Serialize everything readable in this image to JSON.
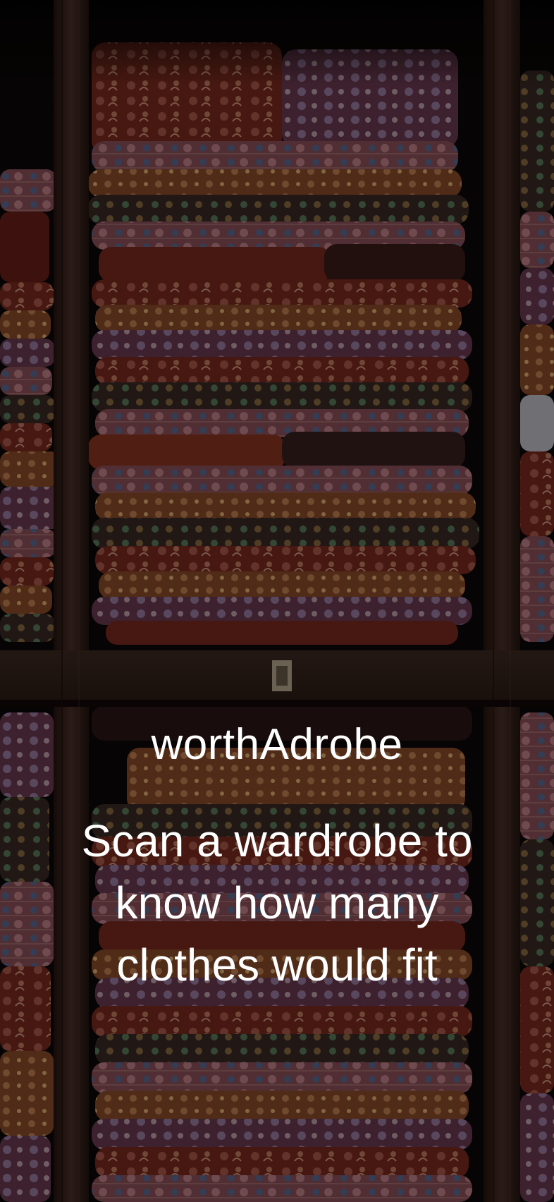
{
  "app": {
    "title": "worthAdrobe",
    "tagline": "Scan a wardrobe to know how many clothes would fit"
  },
  "background": {
    "description_icon": "wardrobe-shelves-with-folded-batik-clothes",
    "colors": {
      "wood": "#3a2520",
      "wood_dark": "#24140f",
      "shelf_shadow": "#060404",
      "fabric_red": "#7a2a1e",
      "fabric_orange": "#8a4a2a",
      "fabric_pink": "#8a5058",
      "fabric_blue": "#4a5a78",
      "fabric_green": "#4a5a3a",
      "fabric_dark": "#2a1816",
      "overlay": "#000000",
      "text": "#ffffff"
    }
  }
}
